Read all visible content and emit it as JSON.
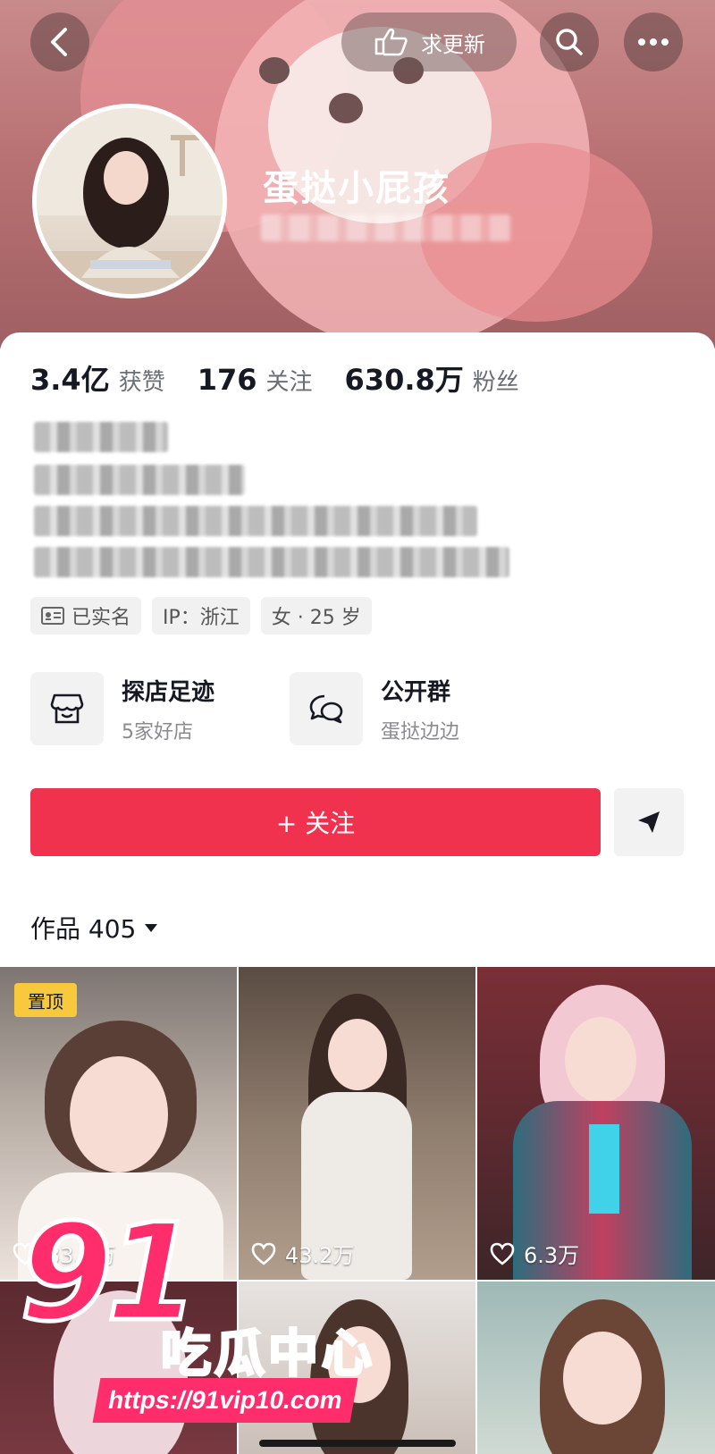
{
  "top_bar": {
    "back_icon": "chevron-left-icon",
    "request_update_label": "求更新",
    "request_update_icon": "pointing-hand-icon",
    "search_icon": "search-icon",
    "more_icon": "more-dots-icon"
  },
  "profile": {
    "nickname": "蛋挞小屁孩",
    "avatar": "avatar-photo"
  },
  "stats": [
    {
      "value": "3.4亿",
      "label": "获赞"
    },
    {
      "value": "176",
      "label": "关注"
    },
    {
      "value": "630.8万",
      "label": "粉丝"
    }
  ],
  "tags": [
    {
      "icon": "id-card-icon",
      "label": "已实名"
    },
    {
      "icon": "",
      "label": "IP：浙江"
    },
    {
      "icon": "",
      "label": "女 · 25 岁"
    }
  ],
  "features": [
    {
      "icon": "store-icon",
      "title": "探店足迹",
      "subtitle": "5家好店"
    },
    {
      "icon": "chat-bubble-icon",
      "title": "公开群",
      "subtitle": "蛋挞边边"
    }
  ],
  "actions": {
    "follow_label": "+ 关注",
    "share_icon": "send-icon"
  },
  "works": {
    "header": "作品 405",
    "dropdown_icon": "triangle-down-icon",
    "items": [
      {
        "pinned": "置顶",
        "likes": "33.9万"
      },
      {
        "pinned": "",
        "likes": "43.2万"
      },
      {
        "pinned": "",
        "likes": "6.3万"
      },
      {
        "pinned": "",
        "likes": ""
      },
      {
        "pinned": "",
        "likes": ""
      },
      {
        "pinned": "",
        "likes": ""
      }
    ]
  },
  "watermark": {
    "number": "91",
    "text": "吃瓜中心",
    "url": "https://91vip10.com"
  },
  "colors": {
    "accent": "#f0324f",
    "pin": "#f9c93d",
    "watermark": "#ff2d6b"
  }
}
